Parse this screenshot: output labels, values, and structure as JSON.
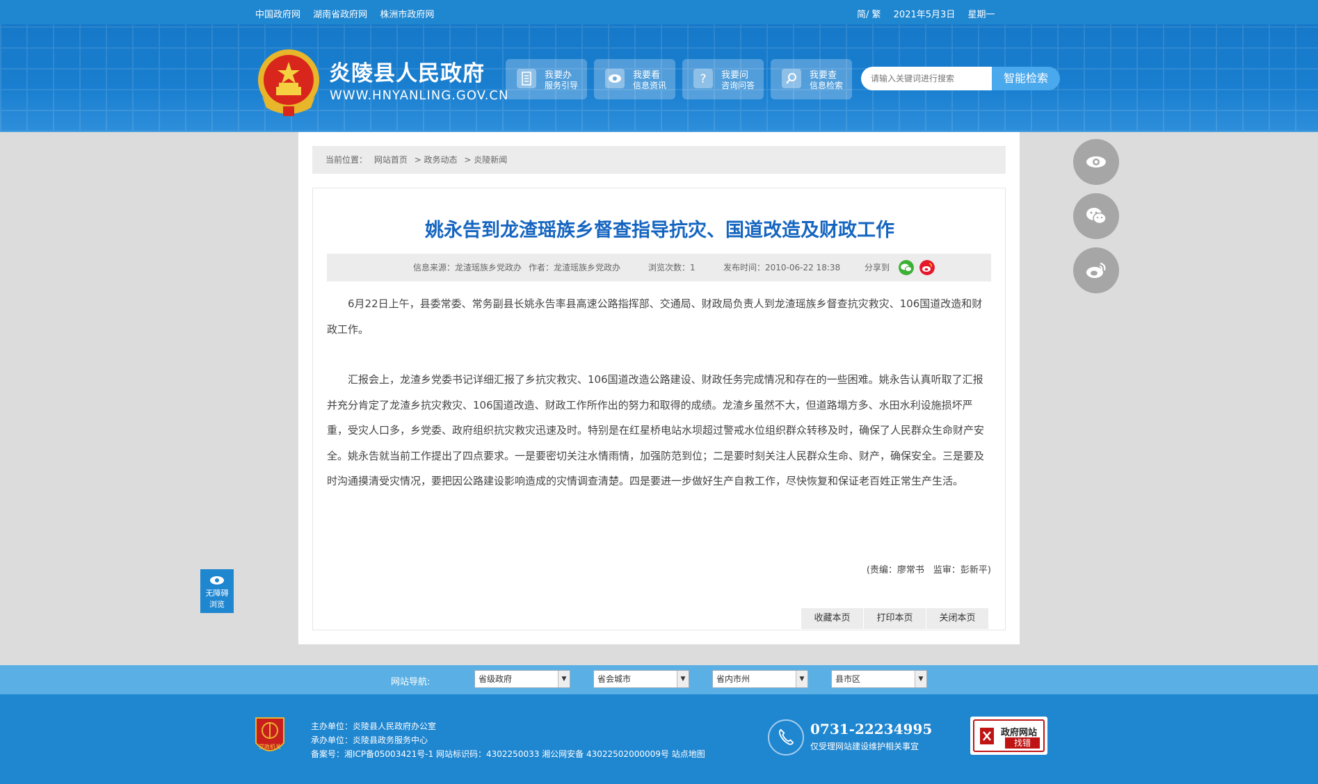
{
  "topbar": {
    "links": [
      "中国政府网",
      "湖南省政府网",
      "株洲市政府网"
    ],
    "lang": "简/ 繁",
    "date": "2021年5月3日",
    "weekday": "星期一"
  },
  "header": {
    "title": "炎陵县人民政府",
    "url": "WWW.HNYANLING.GOV.CN",
    "quick": [
      {
        "line1": "我要办",
        "line2": "服务引导",
        "icon": "document-icon"
      },
      {
        "line1": "我要看",
        "line2": "信息资讯",
        "icon": "eye-icon"
      },
      {
        "line1": "我要问",
        "line2": "咨询问答",
        "icon": "question-icon"
      },
      {
        "line1": "我要查",
        "line2": "信息检索",
        "icon": "search-icon"
      }
    ],
    "search_placeholder": "请输入关键词进行搜索",
    "search_button": "智能检索"
  },
  "breadcrumb": {
    "label": "当前位置：",
    "items": [
      "网站首页",
      "> 政务动态",
      "> 炎陵新闻"
    ]
  },
  "article": {
    "title": "姚永告到龙渣瑶族乡督查指导抗灾、国道改造及财政工作",
    "source": "信息来源：龙渣瑶族乡党政办",
    "author": "作者：龙渣瑶族乡党政办",
    "views": "浏览次数：1",
    "published": "发布时间：2010-06-22 18:38",
    "share_label": "分享到",
    "paragraphs": [
      "6月22日上午，县委常委、常务副县长姚永告率县高速公路指挥部、交通局、财政局负责人到龙渣瑶族乡督查抗灾救灾、106国道改造和财政工作。",
      "汇报会上，龙渣乡党委书记详细汇报了乡抗灾救灾、106国道改造公路建设、财政任务完成情况和存在的一些困难。姚永告认真听取了汇报并充分肯定了龙渣乡抗灾救灾、106国道改造、财政工作所作出的努力和取得的成绩。龙渣乡虽然不大，但道路塌方多、水田水利设施损坏严重，受灾人口多，乡党委、政府组织抗灾救灾迅速及时。特别是在红星桥电站水坝超过警戒水位组织群众转移及时，确保了人民群众生命财产安全。姚永告就当前工作提出了四点要求。一是要密切关注水情雨情，加强防范到位；二是要时刻关注人民群众生命、财产，确保安全。三是要及时沟通摸清受灾情况，要把因公路建设影响造成的灾情调查清楚。四是要进一步做好生产自救工作，尽快恢复和保证老百姓正常生产生活。"
    ],
    "editors": "(责编：廖常书　监审：彭新平)",
    "tools": [
      "收藏本页",
      "打印本页",
      "关闭本页"
    ]
  },
  "accessibility": {
    "line1": "无障碍",
    "line2": "浏览"
  },
  "navbar": {
    "label": "网站导航:",
    "selects": [
      "省级政府",
      "省会城市",
      "省内市州",
      "县市区"
    ]
  },
  "footer": {
    "badge": "党政机关",
    "host": "主办单位：炎陵县人民政府办公室",
    "organizer": "承办单位：炎陵县政务服务中心",
    "record": "备案号：湘ICP备05003421号-1 网站标识码：4302250033 湘公网安备 43022502000009号 站点地图",
    "phone": "0731-22234995",
    "phone_note": "仅受理网站建设维护相关事宜",
    "error_line1": "政府网站",
    "error_line2": "找错"
  },
  "colors": {
    "primary": "#1f86d0",
    "title": "#1565c0",
    "error_red": "#c01414"
  }
}
